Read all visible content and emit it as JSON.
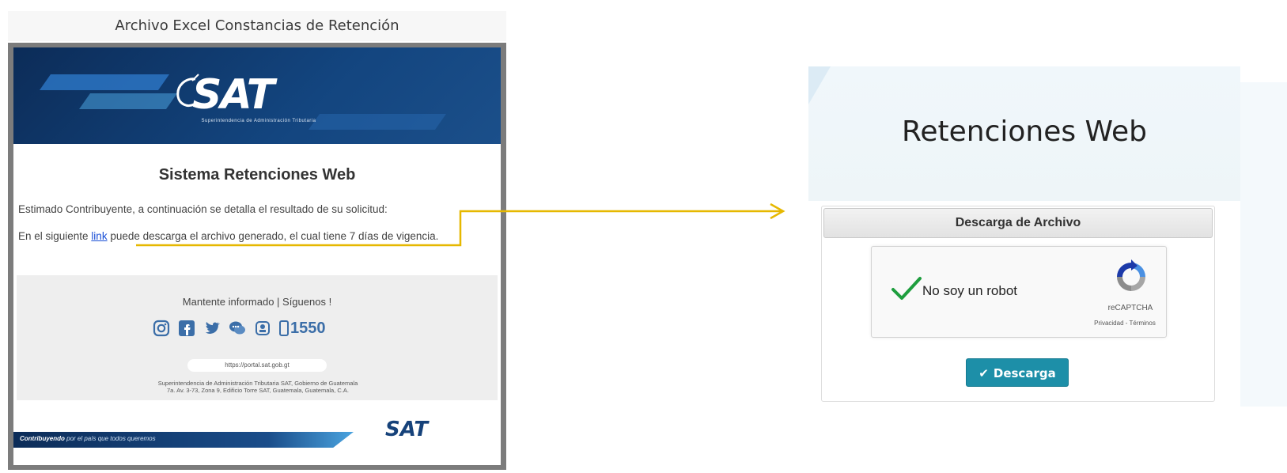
{
  "email": {
    "title": "Archivo Excel Constancias de Retención",
    "banner": {
      "logo_text": "SAT",
      "logo_caption": "Superintendencia de Administración Tributaria"
    },
    "heading": "Sistema Retenciones Web",
    "paragraph1": "Estimado Contribuyente, a continuación se detalla el resultado de su solicitud:",
    "paragraph2_before": "En el siguiente ",
    "paragraph2_link": "link",
    "paragraph2_after": " puede descarga el archivo generado, el cual tiene 7 días de vigencia.",
    "footer": {
      "follow": "Mantente informado | Síguenos !",
      "phone": "1550",
      "portal": "https://portal.sat.gob.gt",
      "address_line1": "Superintendencia de Administración Tributaria SAT, Gobierno de Guatemala",
      "address_line2": "7a. Av. 3-73, Zona 9, Edificio Torre SAT, Guatemala, Guatemala, C.A."
    },
    "slogan_strong": "Contribuyendo",
    "slogan_rest": " por el país que todos queremos",
    "bottom_logo": "SAT"
  },
  "colors": {
    "connector": "#e6b800",
    "banner": "#0c2c58",
    "button": "#1d8fa8",
    "check": "#1e9e3e"
  },
  "web": {
    "title": "Retenciones Web",
    "card_header": "Descarga de Archivo",
    "recaptcha": {
      "label": "No soy un robot",
      "brand": "reCAPTCHA",
      "links": "Privacidad - Términos"
    },
    "button_icon": "✔",
    "button_label": "Descarga"
  }
}
